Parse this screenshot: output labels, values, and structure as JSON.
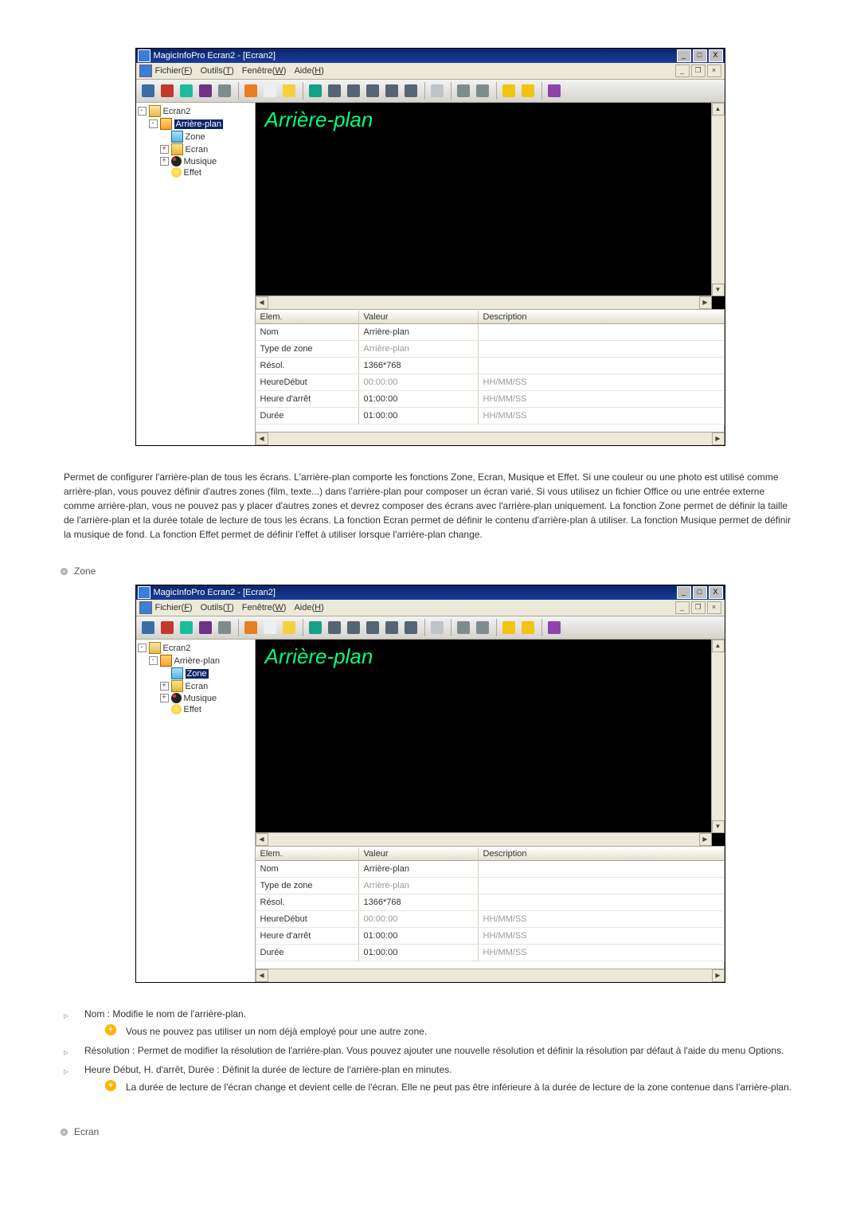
{
  "app": {
    "title": "MagicInfoPro Ecran2 - [Ecran2]",
    "win_controls": {
      "min": "_",
      "max": "□",
      "close": "X"
    },
    "menubar": {
      "file": "Fichier",
      "file_u": "F",
      "tools": "Outils",
      "tools_u": "T",
      "window": "Fenêtre",
      "window_u": "W",
      "help": "Aide",
      "help_u": "H",
      "child": {
        "min": "_",
        "restore": "❐",
        "close": "×"
      }
    },
    "toolbar_colors": [
      "#3a6ea5",
      "#c0392b",
      "#1abc9c",
      "#6c3483",
      "#7f8c8d",
      "#e67e22",
      "#ecf0f1",
      "#f4d03f",
      "#16a085",
      "#566573",
      "#566573",
      "#566573",
      "#566573",
      "#566573",
      "#bdc3c7",
      "#7f8c8d",
      "#7f8c8d",
      "#f1c40f",
      "#f1c40f",
      "#8e44ad"
    ]
  },
  "tree": {
    "root": "Ecran2",
    "ap": "Arrière-plan",
    "zone": "Zone",
    "ecran": "Ecran",
    "musique": "Musique",
    "effet": "Effet"
  },
  "preview_title": "Arrière-plan",
  "grid": {
    "h_elem": "Elem.",
    "h_val": "Valeur",
    "h_desc": "Description",
    "rows": [
      {
        "elem": "Nom",
        "val": "Arrière-plan",
        "desc": "",
        "ro_val": false,
        "hint": ""
      },
      {
        "elem": "Type de zone",
        "val": "Arrière-plan",
        "desc": "",
        "ro_val": true,
        "hint": ""
      },
      {
        "elem": "Résol.",
        "val": "1366*768",
        "desc": "",
        "ro_val": false,
        "hint": ""
      },
      {
        "elem": "HeureDébut",
        "val": "00:00:00",
        "desc": "HH/MM/SS",
        "ro_val": true,
        "hint": ""
      },
      {
        "elem": "Heure d'arrêt",
        "val": "01:00:00",
        "desc": "HH/MM/SS",
        "ro_val": false,
        "hint": ""
      },
      {
        "elem": "Durée",
        "val": "01:00:00",
        "desc": "HH/MM/SS",
        "ro_val": false,
        "hint": ""
      }
    ]
  },
  "paragraph": "Permet de configurer l'arrière-plan de tous les écrans. L'arrière-plan comporte les fonctions Zone, Ecran, Musique et Effet. Si une couleur ou une photo est utilisé comme arrière-plan, vous pouvez définir d'autres zones (film, texte...) dans l'arrière-plan pour composer un écran varié. Si vous utilisez un fichier Office ou une entrée externe comme arrière-plan, vous ne pouvez pas y placer d'autres zones et devrez composer des écrans avec l'arrière-plan uniquement. La fonction Zone permet de définir la taille de l'arrière-plan et la durée totale de lecture de tous les écrans. La fonction Ecran permet de définir le contenu d'arrière-plan à utiliser. La fonction Musique permet de définir la musique de fond. La fonction Effet permet de définir l'effet à utiliser lorsque l'arrière-plan change.",
  "section_zone": "Zone",
  "items": {
    "nom": "Nom : Modifie le nom de l'arrière-plan.",
    "nom_note": "Vous ne pouvez pas utiliser un nom déjà employé pour une autre zone.",
    "resol": "Résolution : Permet de modifier la résolution de l'arrière-plan. Vous pouvez ajouter une nouvelle résolution et définir la résolution par défaut à l'aide du menu Options.",
    "heure": "Heure Début, H. d'arrêt, Durée : Définit la durée de lecture de l'arrière-plan en minutes.",
    "heure_note": "La durée de lecture de l'écran change et devient celle de l'écran. Elle ne peut pas être inférieure à la durée de lecture de la zone contenue dans l'arrière-plan."
  },
  "section_ecran": "Ecran",
  "glyphs": {
    "item_bullet": "▹",
    "up": "▲",
    "down": "▼",
    "left": "◀",
    "right": "▶"
  }
}
